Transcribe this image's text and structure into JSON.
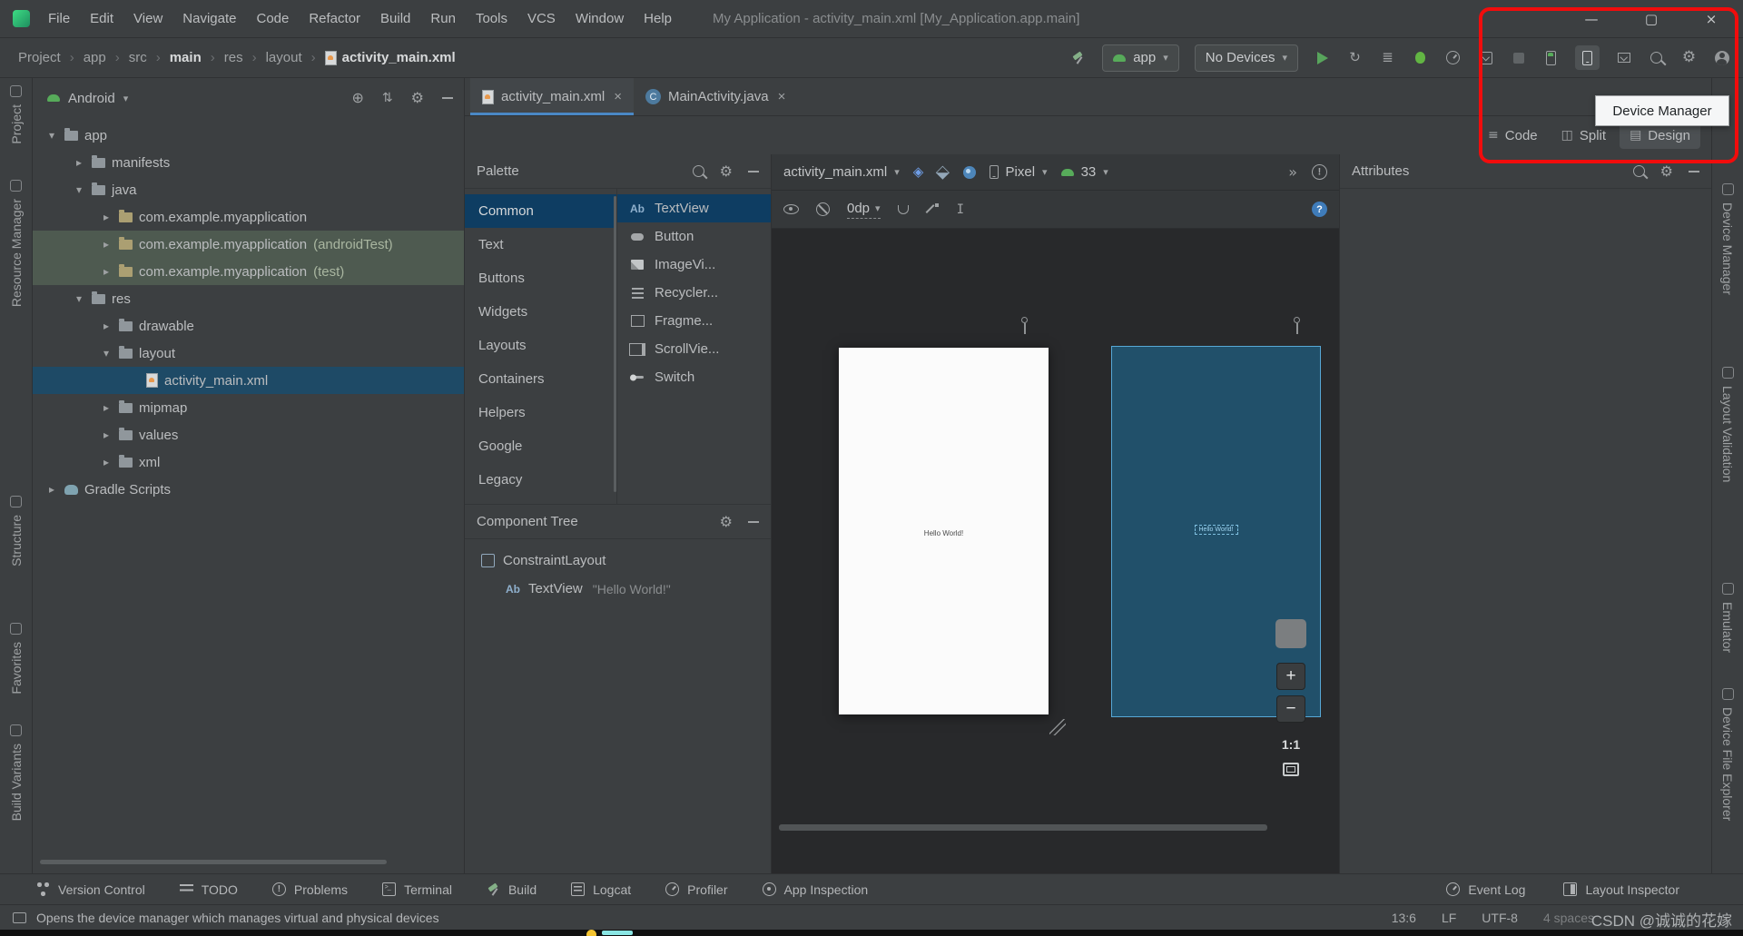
{
  "window": {
    "title": "My Application - activity_main.xml [My_Application.app.main]",
    "controls": {
      "minimize": "—",
      "maximize": "▢",
      "close": "×"
    }
  },
  "menubar": {
    "items": [
      {
        "label": "File"
      },
      {
        "label": "Edit"
      },
      {
        "label": "View"
      },
      {
        "label": "Navigate"
      },
      {
        "label": "Code"
      },
      {
        "label": "Refactor"
      },
      {
        "label": "Build"
      },
      {
        "label": "Run"
      },
      {
        "label": "Tools"
      },
      {
        "label": "VCS"
      },
      {
        "label": "Window"
      },
      {
        "label": "Help"
      }
    ]
  },
  "toolbar": {
    "breadcrumbs": [
      {
        "label": "Project"
      },
      {
        "label": "app"
      },
      {
        "label": "src"
      },
      {
        "label": "main",
        "state": "bold"
      },
      {
        "label": "res"
      },
      {
        "label": "layout"
      },
      {
        "label": "activity_main.xml",
        "icon": "xml-file",
        "state": "bold"
      }
    ],
    "run_config_label": "app",
    "device_label": "No Devices"
  },
  "highlight_tooltip": "Device Manager",
  "stripes": {
    "left": [
      {
        "icon": "project",
        "label": "Project"
      },
      {
        "icon": "resource-manager",
        "label": "Resource Manager"
      },
      {
        "icon": "structure",
        "label": "Structure"
      },
      {
        "icon": "favorites",
        "label": "Favorites"
      },
      {
        "icon": "build-variants",
        "label": "Build Variants"
      }
    ],
    "right": [
      {
        "icon": "device-manager",
        "label": "Device Manager"
      },
      {
        "icon": "layout-validation",
        "label": "Layout Validation"
      },
      {
        "icon": "emulator",
        "label": "Emulator"
      },
      {
        "icon": "device-file-explorer",
        "label": "Device File Explorer"
      }
    ]
  },
  "project_panel": {
    "view_selector": "Android",
    "tree": [
      {
        "label": "app",
        "indent": 0,
        "arrow": "▾",
        "icon": "folder"
      },
      {
        "label": "manifests",
        "indent": 1,
        "arrow": "▸",
        "icon": "folder"
      },
      {
        "label": "java",
        "indent": 1,
        "arrow": "▾",
        "icon": "folder"
      },
      {
        "label": "com.example.myapplication",
        "indent": 2,
        "arrow": "▸",
        "icon": "package"
      },
      {
        "label": "com.example.myapplication",
        "suffix": " (androidTest)",
        "indent": 2,
        "arrow": "▸",
        "icon": "package",
        "state": "testsrc"
      },
      {
        "label": "com.example.myapplication",
        "suffix": " (test)",
        "indent": 2,
        "arrow": "▸",
        "icon": "package",
        "state": "testsrc"
      },
      {
        "label": "res",
        "indent": 1,
        "arrow": "▾",
        "icon": "folder"
      },
      {
        "label": "drawable",
        "indent": 2,
        "arrow": "▸",
        "icon": "folder"
      },
      {
        "label": "layout",
        "indent": 2,
        "arrow": "▾",
        "icon": "folder"
      },
      {
        "label": "activity_main.xml",
        "indent": 3,
        "icon": "xml-file",
        "state": "selected"
      },
      {
        "label": "mipmap",
        "indent": 2,
        "arrow": "▸",
        "icon": "folder"
      },
      {
        "label": "values",
        "indent": 2,
        "arrow": "▸",
        "icon": "folder"
      },
      {
        "label": "xml",
        "indent": 2,
        "arrow": "▸",
        "icon": "folder"
      },
      {
        "label": "Gradle Scripts",
        "indent": 0,
        "arrow": "▸",
        "icon": "gradle"
      }
    ]
  },
  "editor": {
    "tabs": [
      {
        "icon": "xml-file",
        "label": "activity_main.xml",
        "close": "×",
        "state": "active"
      },
      {
        "icon": "java-class",
        "abbr": "C",
        "label": "MainActivity.java",
        "close": "×"
      }
    ],
    "modes": [
      {
        "icon": "code-mode",
        "label": "Code"
      },
      {
        "icon": "split-mode",
        "label": "Split"
      },
      {
        "icon": "design-mode",
        "label": "Design",
        "state": "selected"
      }
    ]
  },
  "palette": {
    "title": "Palette",
    "categories": [
      {
        "label": "Common",
        "state": "selected"
      },
      {
        "label": "Text"
      },
      {
        "label": "Buttons"
      },
      {
        "label": "Widgets"
      },
      {
        "label": "Layouts"
      },
      {
        "label": "Containers"
      },
      {
        "label": "Helpers"
      },
      {
        "label": "Google"
      },
      {
        "label": "Legacy"
      }
    ],
    "items": [
      {
        "icon": "textview",
        "abbr": "Ab",
        "label": "TextView",
        "state": "selected"
      },
      {
        "icon": "button",
        "label": "Button"
      },
      {
        "icon": "imageview",
        "label": "ImageVi..."
      },
      {
        "icon": "recyclerview",
        "label": "Recycler..."
      },
      {
        "icon": "fragment",
        "label": "Fragme..."
      },
      {
        "icon": "scrollview",
        "label": "ScrollVie..."
      },
      {
        "icon": "switch",
        "label": "Switch"
      }
    ]
  },
  "component_tree": {
    "title": "Component Tree",
    "items": [
      {
        "icon": "constraintlayout",
        "label": "ConstraintLayout",
        "indent": 0
      },
      {
        "icon": "textview",
        "abbr": "Ab",
        "label": "TextView",
        "detail": "\"Hello World!\"",
        "indent": 1
      }
    ]
  },
  "design": {
    "file_selector": "activity_main.xml",
    "default_margin": "0dp",
    "device": "Pixel",
    "api_level": "33",
    "overflow_chevrons": "»",
    "preview_text": "Hello World!",
    "zoom_in": "+",
    "zoom_out": "−",
    "zoom_ratio": "1:1"
  },
  "attributes": {
    "title": "Attributes"
  },
  "tool_windows": {
    "left": [
      {
        "icon": "version-control",
        "label": "Version Control"
      },
      {
        "icon": "todo",
        "label": "TODO"
      },
      {
        "icon": "problems",
        "label": "Problems"
      },
      {
        "icon": "terminal",
        "label": "Terminal"
      },
      {
        "icon": "build",
        "label": "Build"
      },
      {
        "icon": "logcat",
        "label": "Logcat"
      },
      {
        "icon": "profiler",
        "label": "Profiler"
      },
      {
        "icon": "app-inspection",
        "label": "App Inspection"
      }
    ],
    "right": [
      {
        "icon": "event-log",
        "label": "Event Log"
      },
      {
        "icon": "layout-inspector",
        "label": "Layout Inspector"
      }
    ]
  },
  "status_bar": {
    "message": "Opens the device manager which manages virtual and physical devices",
    "cursor_position": "13:6",
    "line_separator": "LF",
    "encoding": "UTF-8",
    "indent_style": "4 spaces",
    "watermark": "CSDN @诚诚的花嫁"
  }
}
